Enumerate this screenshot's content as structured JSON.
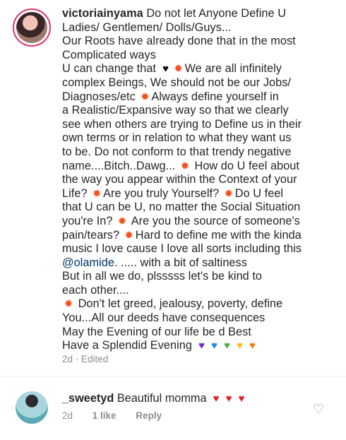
{
  "comment": {
    "username": "victoriainyama",
    "lines": [
      [
        {
          "t": "Do not let Anyone Define U"
        }
      ],
      [
        {
          "t": "Ladies/ Gentlemen/ Dolls/Guys..."
        }
      ],
      [
        {
          "t": "Our Roots have already done that in the most"
        }
      ],
      [
        {
          "t": "Complicated ways"
        }
      ],
      [
        {
          "t": "U can change that "
        },
        {
          "e": "black-heart"
        },
        {
          "e": "sparkle"
        },
        {
          "t": "We are all infinitely"
        }
      ],
      [
        {
          "t": "complex Beings,  We should not be  our Jobs/"
        }
      ],
      [
        {
          "t": "Diagnoses/etc "
        },
        {
          "e": "sparkle"
        },
        {
          "t": "Always define yourself in"
        }
      ],
      [
        {
          "t": "a Realistic/Expansive way so that we clearly"
        }
      ],
      [
        {
          "t": "see when others are trying to Define us in their"
        }
      ],
      [
        {
          "t": "own terms or in relation to what they want us"
        }
      ],
      [
        {
          "t": "to be. Do not conform to that trendy negative"
        }
      ],
      [
        {
          "t": "name....Bitch..Dawg... "
        },
        {
          "e": "sparkle"
        },
        {
          "t": " How do U feel about"
        }
      ],
      [
        {
          "t": "the way you appear within the Context of your"
        }
      ],
      [
        {
          "t": "Life? "
        },
        {
          "e": "sparkle"
        },
        {
          "t": "Are you truly Yourself? "
        },
        {
          "e": "sparkle"
        },
        {
          "t": "Do U feel"
        }
      ],
      [
        {
          "t": "that U can be U,  no matter the Social Situation"
        }
      ],
      [
        {
          "t": "you're In? "
        },
        {
          "e": "sparkle"
        },
        {
          "t": " Are you the source of someone's"
        }
      ],
      [
        {
          "t": "pain/tears? "
        },
        {
          "e": "sparkle"
        },
        {
          "t": "Hard to define me with the kinda"
        }
      ],
      [
        {
          "t": "music I love cause I love all sorts including this"
        }
      ],
      [
        {
          "m": "@olamide."
        },
        {
          "t": " ..... with a bit of saltiness"
        }
      ],
      [
        {
          "t": "But in all we do, plsssss let's be kind to"
        }
      ],
      [
        {
          "t": "each other...."
        }
      ],
      [
        {
          "e": "sparkle"
        },
        {
          "t": " Don't let greed, jealousy, poverty, define"
        }
      ],
      [
        {
          "t": "You...All our deeds have consequences"
        }
      ],
      [
        {
          "t": "May the Evening of our life be d Best"
        }
      ],
      [
        {
          "t": "Have a Splendid Evening "
        },
        {
          "e": "purple-heart"
        },
        {
          "e": "blue-heart"
        },
        {
          "e": "green-heart"
        },
        {
          "e": "yellow-heart"
        },
        {
          "e": "orange-heart"
        }
      ]
    ],
    "meta": "2d · Edited"
  },
  "reply": {
    "username": "_sweetyd",
    "text": " Beautiful momma ",
    "hearts": [
      "red-heart",
      "red-heart",
      "red-heart"
    ],
    "time": "2d",
    "likes": "1 like",
    "reply_label": "Reply"
  },
  "icons": {
    "sparkle": "✹",
    "black-heart": "♥",
    "red-heart": "♥",
    "purple-heart": "♥",
    "blue-heart": "♥",
    "green-heart": "♥",
    "yellow-heart": "♥",
    "orange-heart": "♥",
    "like": "♡"
  }
}
